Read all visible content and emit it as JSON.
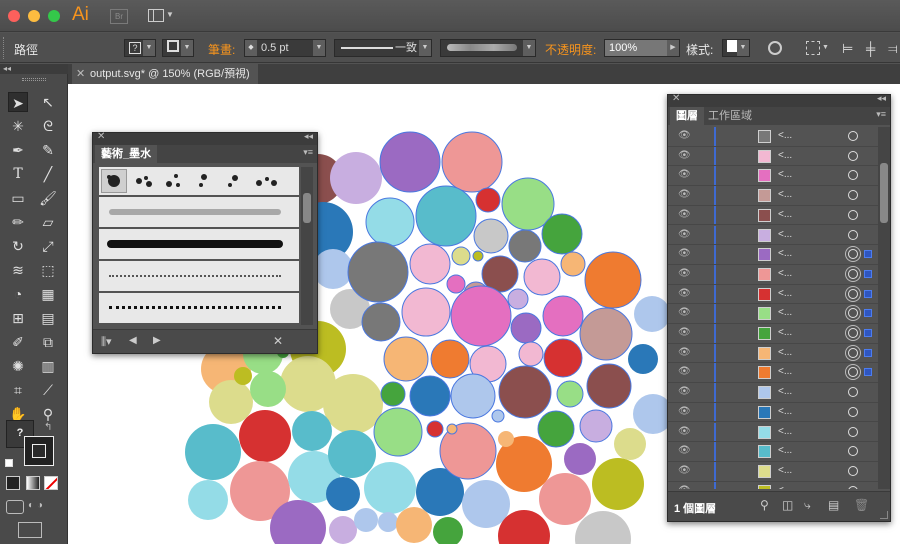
{
  "app": {
    "logo": "Ai",
    "bridge": "Br",
    "traffic": [
      "#fc605c",
      "#fdbc40",
      "#34c84a"
    ]
  },
  "control": {
    "object_type": "路徑",
    "stroke_label": "筆畫:",
    "stroke_value": "0.5 pt",
    "stroke_profile": "一致",
    "opacity_label": "不透明度:",
    "opacity_value": "100%",
    "style_label": "樣式:"
  },
  "document_tab": {
    "label": "output.svg* @ 150% (RGB/預視)"
  },
  "brush_panel": {
    "title": "藝術_墨水"
  },
  "layers_panel": {
    "tab_layers": "圖層",
    "tab_artboards": "工作區域",
    "footer": "1 個圖層",
    "rows": [
      {
        "color": "#787878",
        "name": "<...",
        "targeted": false,
        "selected": false
      },
      {
        "color": "#f2b8d2",
        "name": "<...",
        "targeted": false,
        "selected": false
      },
      {
        "color": "#e46fc0",
        "name": "<...",
        "targeted": false,
        "selected": false
      },
      {
        "color": "#c49a96",
        "name": "<...",
        "targeted": false,
        "selected": false
      },
      {
        "color": "#8b4f4e",
        "name": "<...",
        "targeted": false,
        "selected": false
      },
      {
        "color": "#c8aee0",
        "name": "<...",
        "targeted": false,
        "selected": false
      },
      {
        "color": "#9b6ac2",
        "name": "<...",
        "targeted": true,
        "selected": true
      },
      {
        "color": "#ee9796",
        "name": "<...",
        "targeted": true,
        "selected": true
      },
      {
        "color": "#d63131",
        "name": "<...",
        "targeted": true,
        "selected": true
      },
      {
        "color": "#98de86",
        "name": "<...",
        "targeted": true,
        "selected": true
      },
      {
        "color": "#45a43d",
        "name": "<...",
        "targeted": true,
        "selected": true
      },
      {
        "color": "#f6b675",
        "name": "<...",
        "targeted": true,
        "selected": true
      },
      {
        "color": "#ef7b30",
        "name": "<...",
        "targeted": true,
        "selected": true
      },
      {
        "color": "#aec7ec",
        "name": "<...",
        "targeted": false,
        "selected": false
      },
      {
        "color": "#2a78b8",
        "name": "<...",
        "targeted": false,
        "selected": false
      },
      {
        "color": "#94dce7",
        "name": "<...",
        "targeted": false,
        "selected": false
      },
      {
        "color": "#58bccb",
        "name": "<...",
        "targeted": false,
        "selected": false
      },
      {
        "color": "#dcdc8c",
        "name": "<...",
        "targeted": false,
        "selected": false
      },
      {
        "color": "#bcbd22",
        "name": "<...",
        "targeted": false,
        "selected": false
      }
    ]
  }
}
